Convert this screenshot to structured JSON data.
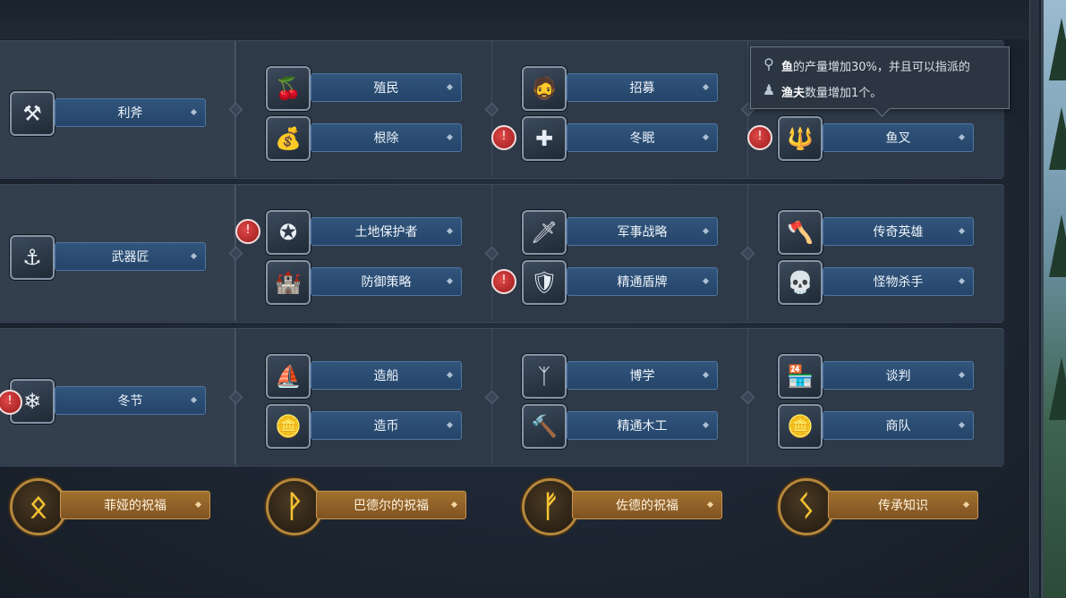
{
  "tooltip": {
    "line1_bold": "鱼",
    "line1_rest": "的产量增加30%，并且可以指派的",
    "line2_bold": "渔夫",
    "line2_rest": "数量增加1个。"
  },
  "rows": [
    {
      "root": {
        "label": "利斧",
        "icon": "axe-hammer-icon",
        "glyph": "⚒"
      },
      "columns": [
        [
          {
            "label": "殖民",
            "icon": "food-bowl-icon",
            "glyph": "🍒"
          },
          {
            "label": "根除",
            "icon": "sack-icon",
            "glyph": "💰"
          }
        ],
        [
          {
            "label": "招募",
            "icon": "warrior-portrait-icon",
            "glyph": "🧔"
          },
          {
            "label": "冬眠",
            "icon": "green-cross-icon",
            "glyph": "✚",
            "badge": true
          }
        ],
        [
          {
            "label": "",
            "icon": "",
            "glyph": ""
          },
          {
            "label": "鱼叉",
            "icon": "harpoon-icon",
            "glyph": "🔱",
            "badge": true
          }
        ]
      ]
    },
    {
      "root": {
        "label": "武器匠",
        "icon": "anvil-icon",
        "glyph": "⚓"
      },
      "columns": [
        [
          {
            "label": "土地保护者",
            "icon": "shield-emblem-icon",
            "glyph": "✪",
            "badge": true
          },
          {
            "label": "防御策略",
            "icon": "watchtower-icon",
            "glyph": "🏰"
          }
        ],
        [
          {
            "label": "军事战略",
            "icon": "sword-icon",
            "glyph": "🗡"
          },
          {
            "label": "精通盾牌",
            "icon": "round-shield-icon",
            "glyph": "🛡",
            "badge": true
          }
        ],
        [
          {
            "label": "传奇英雄",
            "icon": "double-axe-icon",
            "glyph": "🪓"
          },
          {
            "label": "怪物杀手",
            "icon": "skull-icon",
            "glyph": "💀"
          }
        ]
      ]
    },
    {
      "root": {
        "label": "冬节",
        "icon": "snowflake-rune-icon",
        "glyph": "❄",
        "badge_left": true
      },
      "columns": [
        [
          {
            "label": "造船",
            "icon": "longship-icon",
            "glyph": "⛵"
          },
          {
            "label": "造币",
            "icon": "coin-icon",
            "glyph": "🪙"
          }
        ],
        [
          {
            "label": "博学",
            "icon": "rune-stone-icon",
            "glyph": "ᛉ"
          },
          {
            "label": "精通木工",
            "icon": "hammer-icon",
            "glyph": "🔨"
          }
        ],
        [
          {
            "label": "谈判",
            "icon": "market-stall-icon",
            "glyph": "🏪"
          },
          {
            "label": "商队",
            "icon": "caravan-icon",
            "glyph": "🪙"
          }
        ]
      ]
    }
  ],
  "blessings": [
    {
      "label": "菲娅的祝福",
      "rune": "ᛟ",
      "icon": "othala-rune-icon"
    },
    {
      "label": "巴德尔的祝福",
      "rune": "ᚹ",
      "icon": "wunjo-rune-icon"
    },
    {
      "label": "佐德的祝福",
      "rune": "ᚠ",
      "icon": "fehu-rune-icon"
    },
    {
      "label": "传承知识",
      "rune": "ᛊ",
      "icon": "sowilo-rune-icon"
    }
  ],
  "badge_glyph": "🐻",
  "colors": {
    "blue_bar": "#2b4d74",
    "gold_bar": "#946528",
    "badge_red": "#c03030",
    "rune_gold": "#f6c232"
  }
}
